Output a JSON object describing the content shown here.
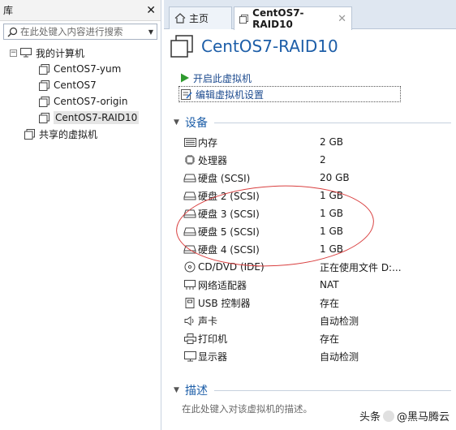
{
  "library": {
    "title": "库",
    "search_placeholder": "在此处键入内容进行搜索",
    "tree": {
      "root_label": "我的计算机",
      "vms": [
        "CentOS7-yum",
        "CentOS7",
        "CentOS7-origin",
        "CentOS7-RAID10"
      ],
      "selected": "CentOS7-RAID10",
      "shared_label": "共享的虚拟机"
    }
  },
  "tabs": [
    {
      "label": "主页",
      "icon": "home-icon"
    },
    {
      "label": "CentOS7-RAID10",
      "icon": "vm-icon",
      "active": true
    }
  ],
  "vm": {
    "title": "CentOS7-RAID10",
    "actions": {
      "start": "开启此虚拟机",
      "edit": "编辑虚拟机设置"
    }
  },
  "devices_section": {
    "title": "设备",
    "items": [
      {
        "name": "内存",
        "value": "2 GB",
        "icon": "memory-icon"
      },
      {
        "name": "处理器",
        "value": "2",
        "icon": "cpu-icon"
      },
      {
        "name": "硬盘 (SCSI)",
        "value": "20 GB",
        "icon": "disk-icon"
      },
      {
        "name": "硬盘 2 (SCSI)",
        "value": "1 GB",
        "icon": "disk-icon"
      },
      {
        "name": "硬盘 3 (SCSI)",
        "value": "1 GB",
        "icon": "disk-icon"
      },
      {
        "name": "硬盘 5 (SCSI)",
        "value": "1 GB",
        "icon": "disk-icon"
      },
      {
        "name": "硬盘 4 (SCSI)",
        "value": "1 GB",
        "icon": "disk-icon"
      },
      {
        "name": "CD/DVD (IDE)",
        "value": "正在使用文件 D:...",
        "icon": "cdrom-icon"
      },
      {
        "name": "网络适配器",
        "value": "NAT",
        "icon": "network-icon"
      },
      {
        "name": "USB 控制器",
        "value": "存在",
        "icon": "usb-icon"
      },
      {
        "name": "声卡",
        "value": "自动检测",
        "icon": "speaker-icon"
      },
      {
        "name": "打印机",
        "value": "存在",
        "icon": "printer-icon"
      },
      {
        "name": "显示器",
        "value": "自动检测",
        "icon": "monitor-icon"
      }
    ]
  },
  "description_section": {
    "title": "描述",
    "placeholder": "在此处键入对该虚拟机的描述。"
  },
  "watermark": {
    "prefix": "头条",
    "handle": "@黑马腾云"
  },
  "colors": {
    "accent": "#1d5ea8",
    "annotation": "#d94040"
  }
}
